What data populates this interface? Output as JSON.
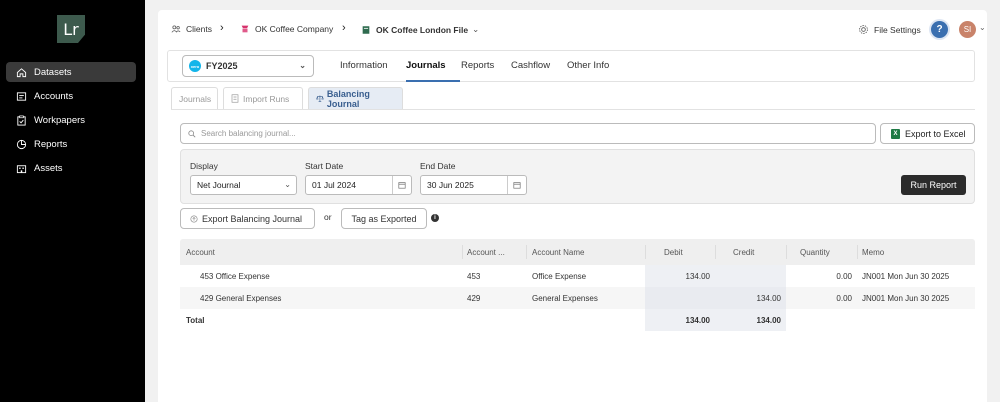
{
  "app": {
    "logo_text": "Lr"
  },
  "sidebar": {
    "items": [
      {
        "label": "Datasets",
        "icon": "home-icon",
        "active": true
      },
      {
        "label": "Accounts",
        "icon": "ledger-icon",
        "active": false
      },
      {
        "label": "Workpapers",
        "icon": "clipboard-icon",
        "active": false
      },
      {
        "label": "Reports",
        "icon": "pie-chart-icon",
        "active": false
      },
      {
        "label": "Assets",
        "icon": "building-icon",
        "active": false
      }
    ]
  },
  "header": {
    "breadcrumb": {
      "clients": "Clients",
      "company": "OK Coffee Company",
      "file": "OK Coffee London File"
    },
    "file_settings": "File Settings",
    "help": "?",
    "avatar_initials": "SI"
  },
  "tabs": {
    "period": "FY2025",
    "xero_badge": "xero",
    "items": [
      "Information",
      "Journals",
      "Reports",
      "Cashflow",
      "Other Info"
    ],
    "active": "Journals"
  },
  "subtabs": {
    "items": [
      "Journals",
      "Import Runs",
      "Balancing Journal"
    ],
    "active": "Balancing Journal"
  },
  "search": {
    "placeholder": "Search balancing journal..."
  },
  "export_excel": "Export to Excel",
  "filters": {
    "display_label": "Display",
    "display_value": "Net Journal",
    "start_label": "Start Date",
    "start_value": "01 Jul 2024",
    "end_label": "End Date",
    "end_value": "30 Jun 2025",
    "run": "Run Report"
  },
  "actions": {
    "export_journal": "Export Balancing Journal",
    "or": "or",
    "tag": "Tag as Exported"
  },
  "table": {
    "columns": [
      "Account",
      "Account ...",
      "Account Name",
      "Debit",
      "Credit",
      "Quantity",
      "Memo"
    ],
    "rows": [
      {
        "account": "453 Office Expense",
        "code": "453",
        "name": "Office Expense",
        "debit": "134.00",
        "credit": "",
        "qty": "0.00",
        "memo": "JN001 Mon Jun 30 2025"
      },
      {
        "account": "429 General Expenses",
        "code": "429",
        "name": "General Expenses",
        "debit": "",
        "credit": "134.00",
        "qty": "0.00",
        "memo": "JN001 Mon Jun 30 2025"
      }
    ],
    "total": {
      "label": "Total",
      "debit": "134.00",
      "credit": "134.00"
    }
  },
  "colors": {
    "accent": "#3a6fb0",
    "sidebar": "#000000",
    "excel": "#1f7a45"
  }
}
